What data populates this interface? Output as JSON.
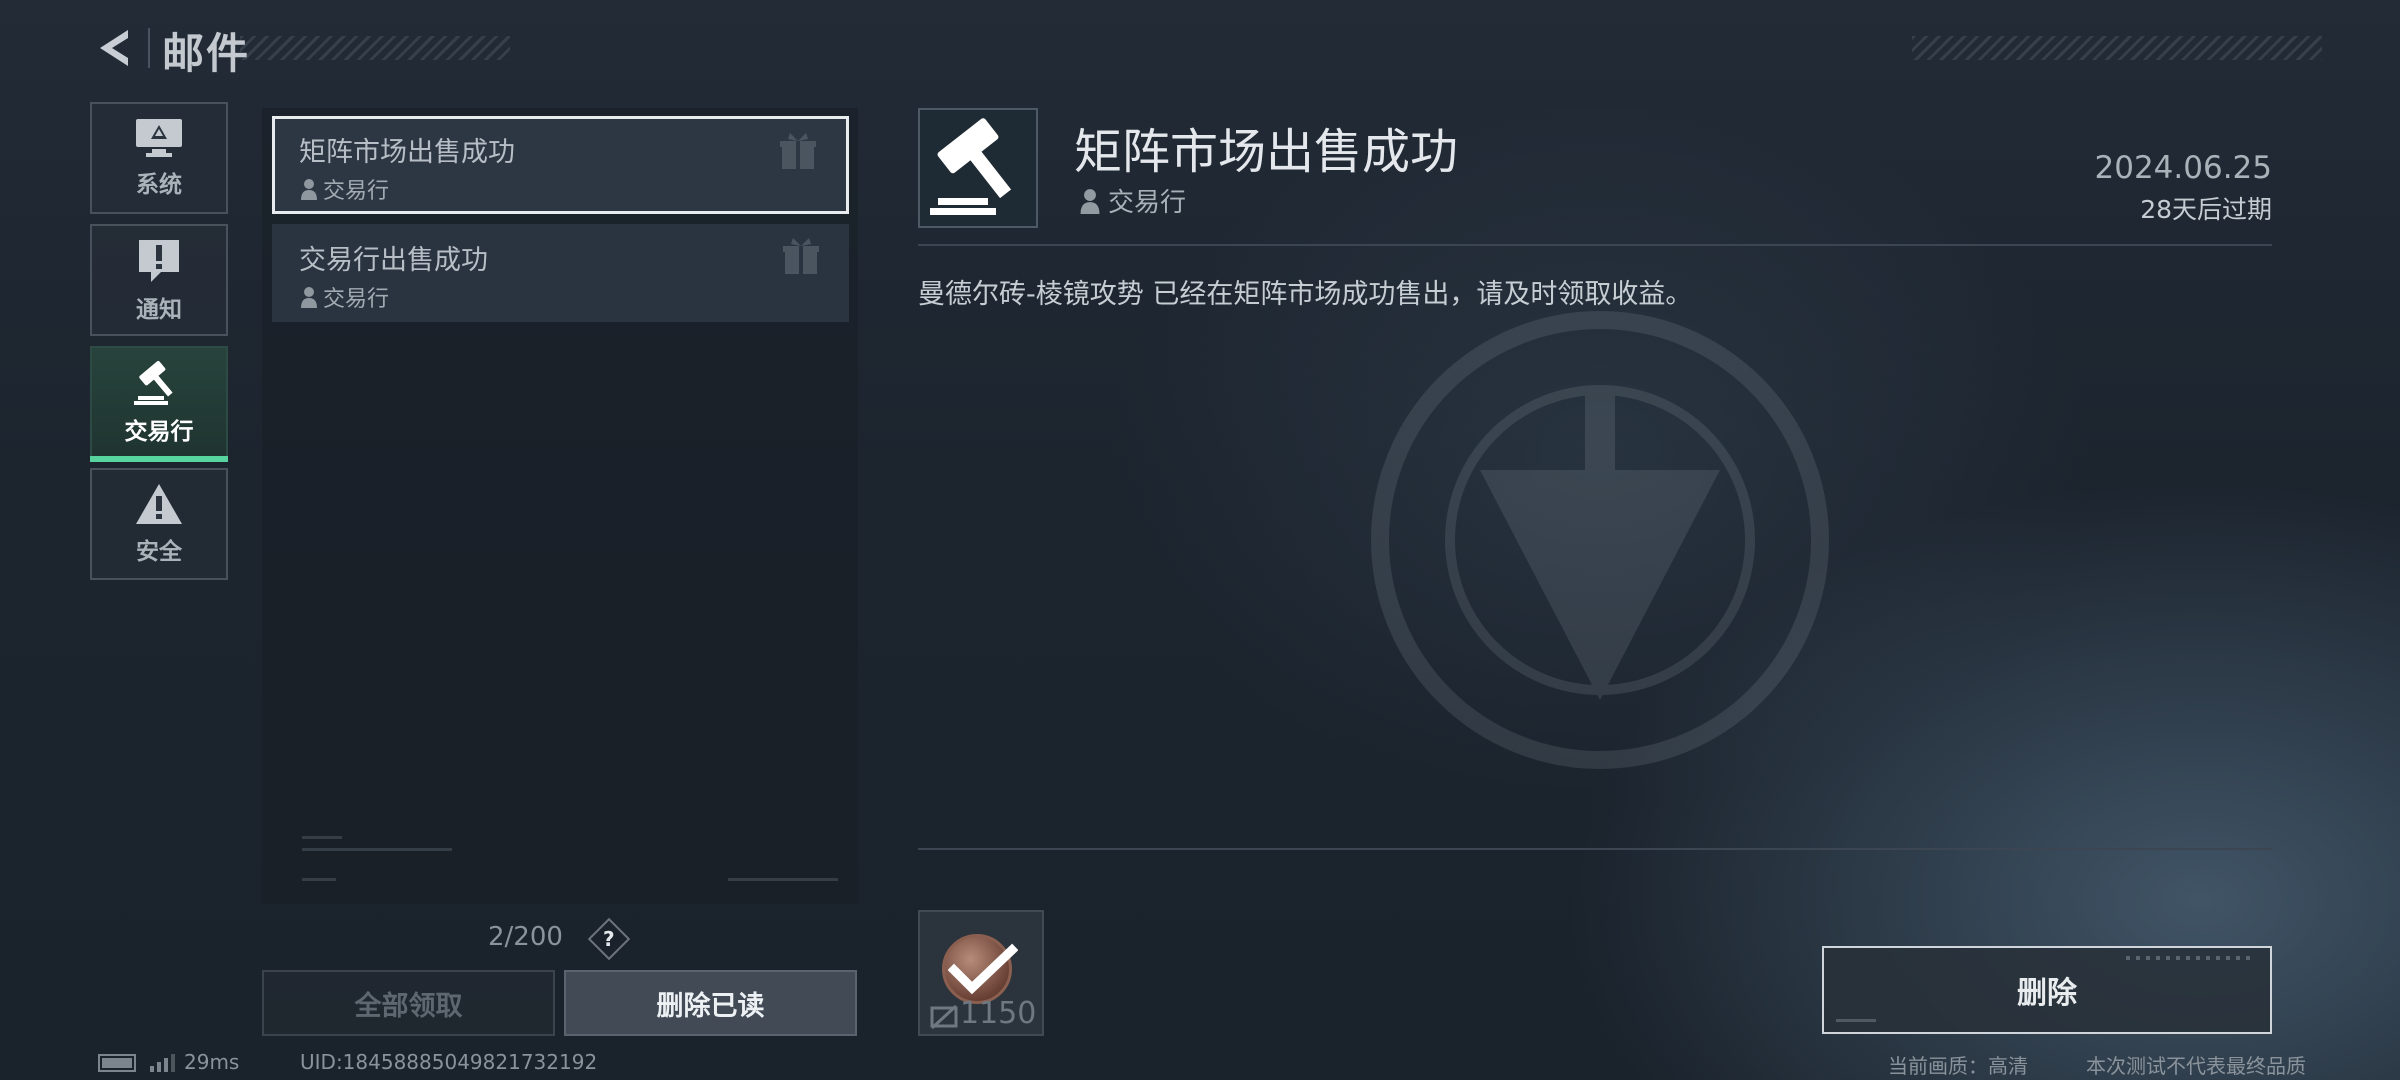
{
  "header": {
    "title": "邮件"
  },
  "sidebar": {
    "items": [
      {
        "label": "系统",
        "icon": "monitor-icon",
        "active": false
      },
      {
        "label": "通知",
        "icon": "exclamation-icon",
        "active": false
      },
      {
        "label": "交易行",
        "icon": "gavel-icon",
        "active": true
      },
      {
        "label": "安全",
        "icon": "warning-icon",
        "active": false
      }
    ]
  },
  "mail_list": {
    "items": [
      {
        "subject": "矩阵市场出售成功",
        "sender": "交易行",
        "selected": true
      },
      {
        "subject": "交易行出售成功",
        "sender": "交易行",
        "selected": false
      }
    ],
    "counter": "2/200",
    "help_label": "?",
    "claim_all_label": "全部领取",
    "delete_read_label": "删除已读"
  },
  "detail": {
    "title": "矩阵市场出售成功",
    "sender": "交易行",
    "date": "2024.06.25",
    "expiry": "28天后过期",
    "body": "曼德尔砖-棱镜攻势 已经在矩阵市场成功售出，请及时领取收益。",
    "attachment": {
      "count": "1150",
      "claimed": true
    },
    "delete_label": "删除"
  },
  "status_bar": {
    "ping": "29ms",
    "uid": "UID:18458885049821732192",
    "quality": "当前画质：高清",
    "disclaimer": "本次测试不代表最终品质"
  },
  "colors": {
    "accent": "#58d49e",
    "selected_border": "#e9ecef"
  }
}
